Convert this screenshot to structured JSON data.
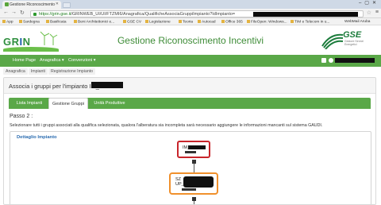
{
  "browser": {
    "tab_title": "Gestione Riconoscimento",
    "url_secure": "https://grin.gse.it",
    "url_path": "/GRINWEB_UI/UI/FTZMI6/Anagrafica/QualificheAssociaGruppiImpianto?IdImpianto=",
    "bookmarks": [
      "App",
      "Sardegna",
      "Basilicata",
      "Beni Architettonici e...",
      "GSE CV",
      "Legislazione",
      "Teoria",
      "Autocad",
      "Office 365",
      "FileOpen: Windows...",
      "TIM e Telecom in u...",
      "WebMail Aruba"
    ]
  },
  "header": {
    "logo_gr": "GR",
    "logo_i": "I",
    "logo_n": "N",
    "title": "Gestione Riconoscimento Incentivi",
    "gse_logo": "GSE",
    "gse_sub": "Gestore Servizi Energetici"
  },
  "nav": {
    "home": "Home Page",
    "anagrafica": "Anagrafica ▾",
    "convenzioni": "Convenzioni ▾"
  },
  "breadcrumb": [
    "Anagrafica",
    "Impianti",
    "Registrazione Impianto"
  ],
  "main": {
    "heading": "Associa i gruppi per l'impianto IM_",
    "tabs": [
      "Lista Impianti",
      "Gestione Gruppi",
      "Unità Produttive"
    ],
    "active_tab": 1,
    "step": "Passo 2 :",
    "description": "Selezionare tutti i gruppi associati alla qualifica selezionata, qualora l'alberatura sia incompleta sarà necessario aggiungere le informazioni mancanti sul sistema GAUDI.",
    "detail_title": "Dettaglio Impianto",
    "node_plant_prefix": "IM_",
    "node_group_prefix": "SZ",
    "node_unit_prefix": "UP_"
  },
  "colors": {
    "brand_green": "#5aa848",
    "title_green": "#3e8c37",
    "link_blue": "#2b6cb0",
    "node_red": "#c8252b",
    "node_orange": "#f0902c"
  }
}
